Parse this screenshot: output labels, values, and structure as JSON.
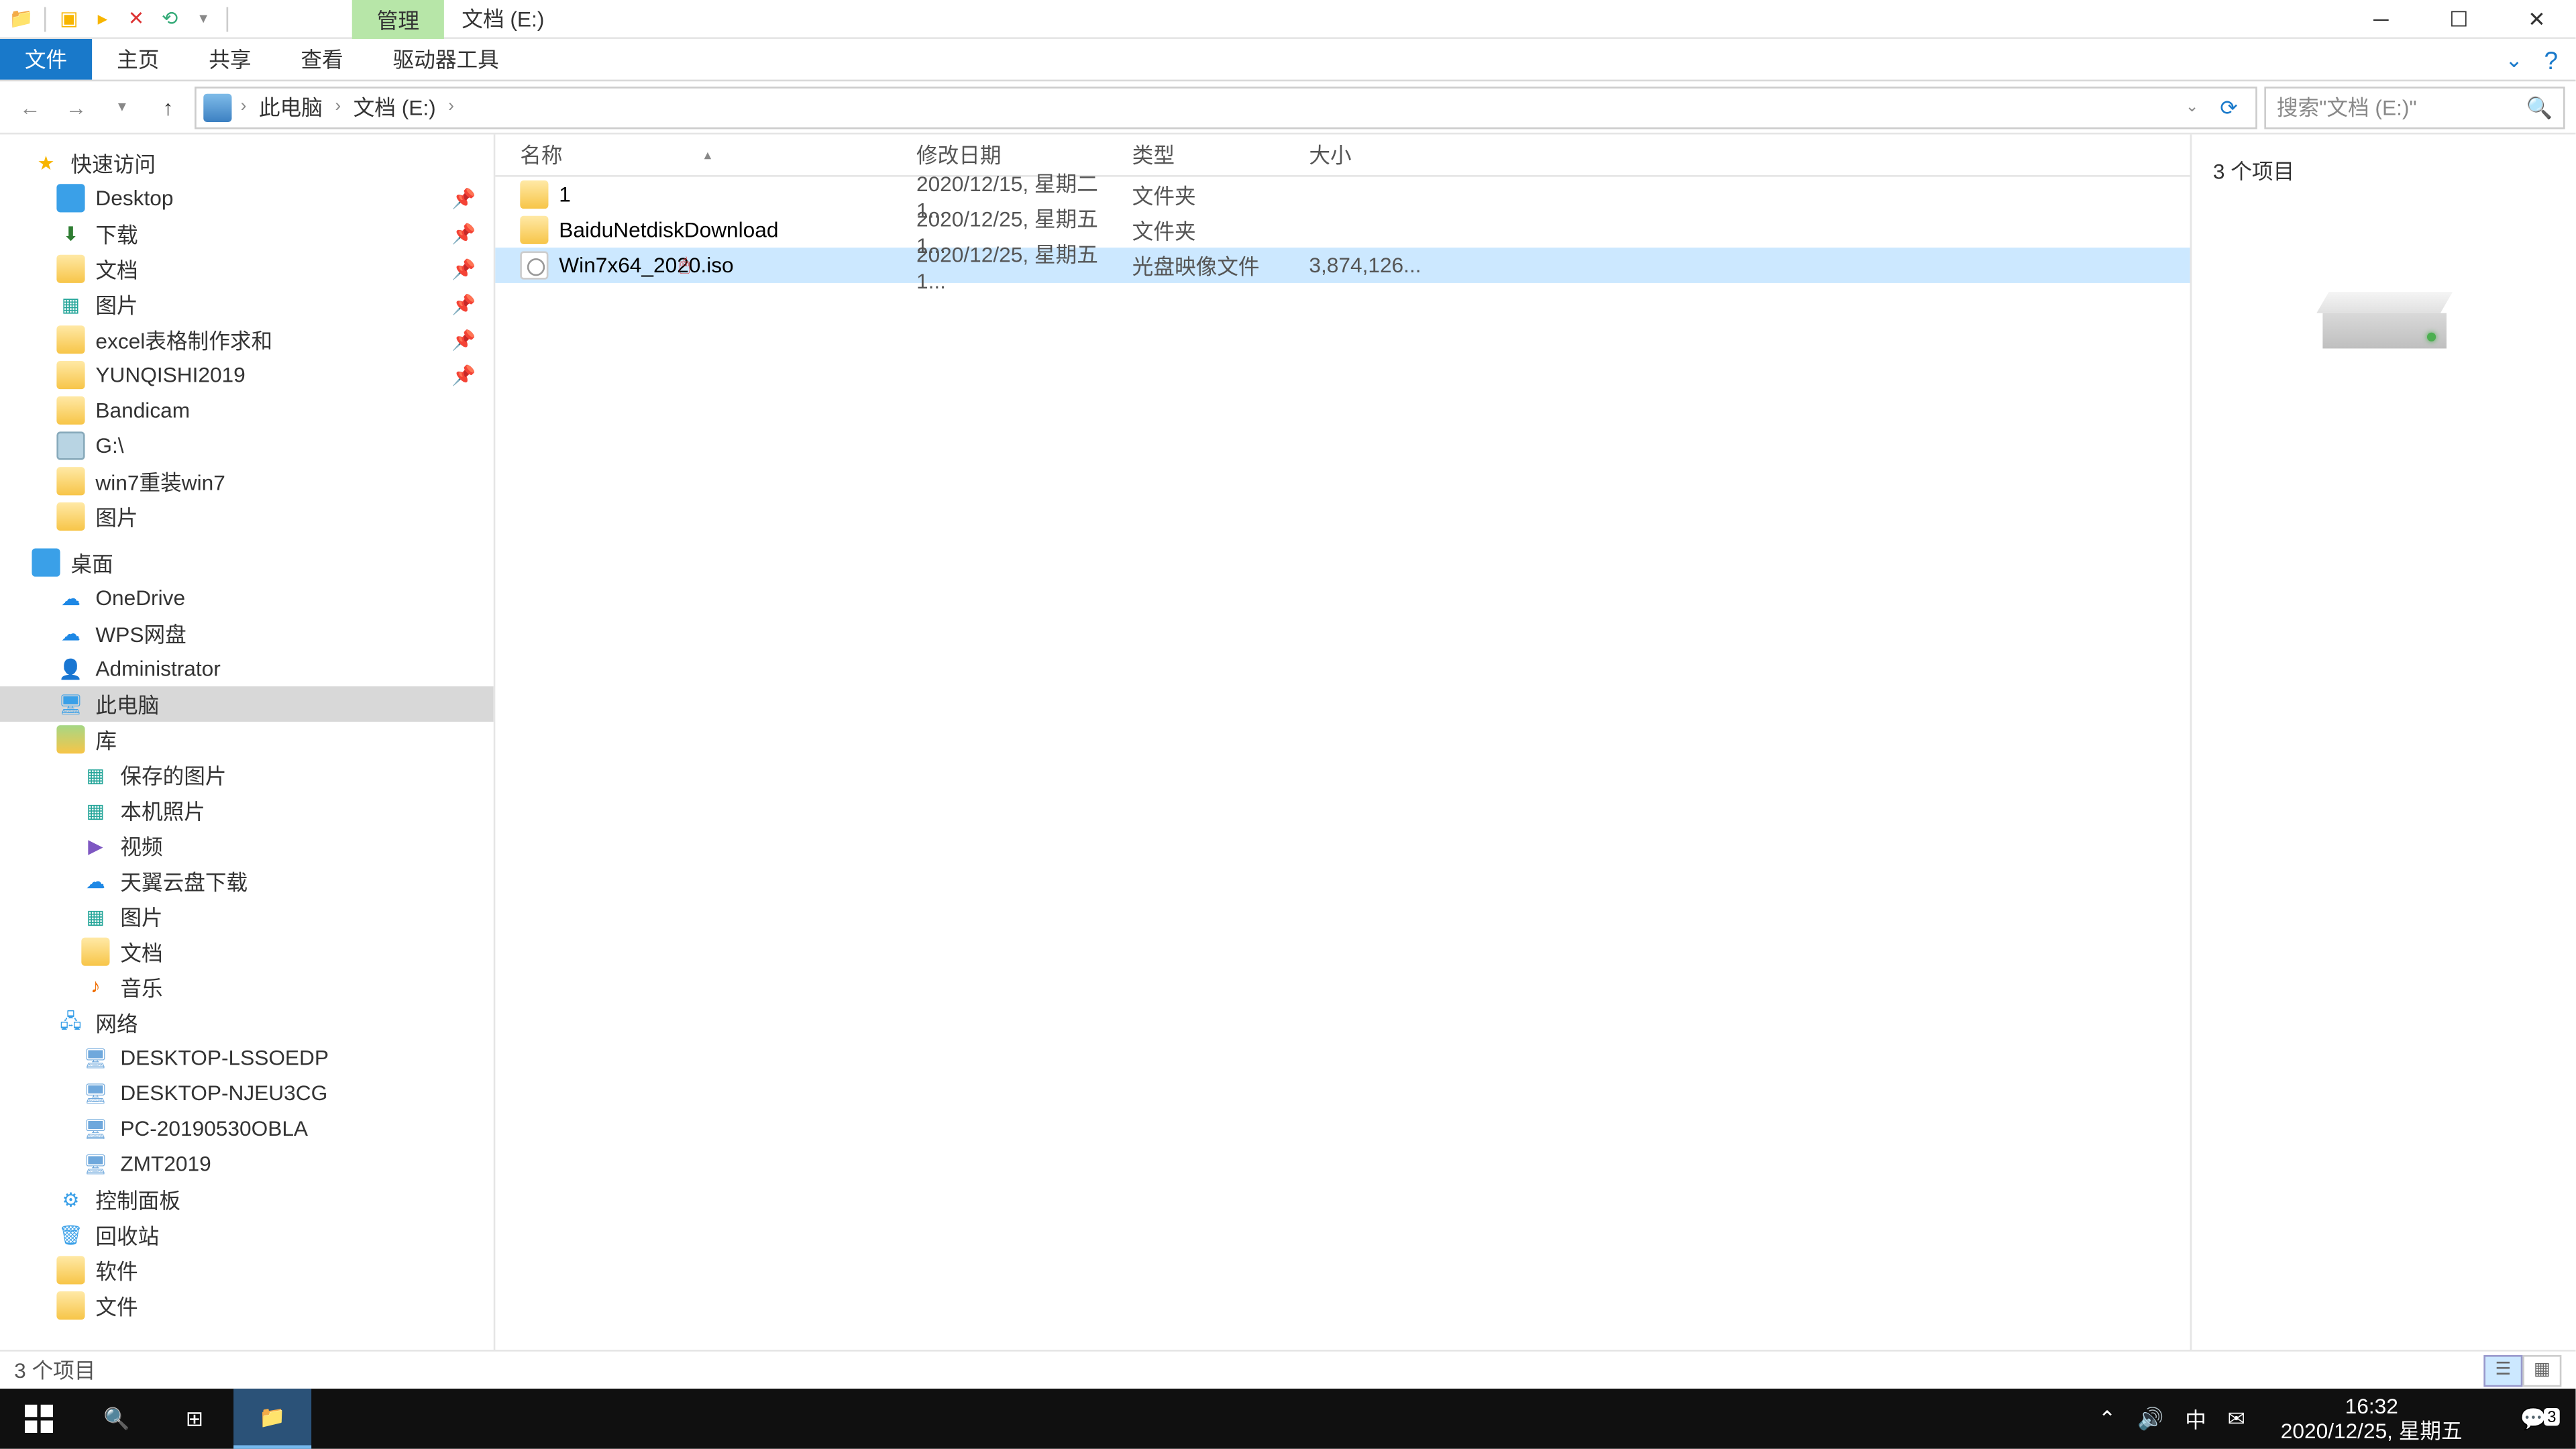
{
  "titlebar": {
    "context_tab": "管理",
    "title": "文档 (E:)"
  },
  "ribbon": {
    "file": "文件",
    "home": "主页",
    "share": "共享",
    "view": "查看",
    "drive_tools": "驱动器工具"
  },
  "address": {
    "crumb_pc": "此电脑",
    "crumb_drive": "文档 (E:)",
    "search_placeholder": "搜索\"文档 (E:)\""
  },
  "nav": {
    "quick_access": "快速访问",
    "desktop": "Desktop",
    "downloads": "下载",
    "documents": "文档",
    "pictures": "图片",
    "excel": "excel表格制作求和",
    "yunqishi": "YUNQISHI2019",
    "bandicam": "Bandicam",
    "gdrive": "G:\\",
    "win7reinstall": "win7重装win7",
    "pictures2": "图片",
    "desktop_cn": "桌面",
    "onedrive": "OneDrive",
    "wps": "WPS网盘",
    "admin": "Administrator",
    "thispc": "此电脑",
    "library": "库",
    "saved_pics": "保存的图片",
    "camera_roll": "本机照片",
    "videos": "视频",
    "tianyi": "天翼云盘下载",
    "pics_lib": "图片",
    "docs_lib": "文档",
    "music": "音乐",
    "network": "网络",
    "pc1": "DESKTOP-LSSOEDP",
    "pc2": "DESKTOP-NJEU3CG",
    "pc3": "PC-20190530OBLA",
    "pc4": "ZMT2019",
    "control_panel": "控制面板",
    "recycle": "回收站",
    "software": "软件",
    "files": "文件"
  },
  "columns": {
    "name": "名称",
    "date": "修改日期",
    "type": "类型",
    "size": "大小"
  },
  "files": [
    {
      "name": "1",
      "date": "2020/12/15, 星期二 1...",
      "type": "文件夹",
      "size": "",
      "icon": "folder",
      "selected": false
    },
    {
      "name": "BaiduNetdiskDownload",
      "date": "2020/12/25, 星期五 1...",
      "type": "文件夹",
      "size": "",
      "icon": "folder",
      "selected": false
    },
    {
      "name": "Win7x64_2020.iso",
      "date": "2020/12/25, 星期五 1...",
      "type": "光盘映像文件",
      "size": "3,874,126...",
      "icon": "iso",
      "selected": true
    }
  ],
  "preview": {
    "count_label": "3 个项目"
  },
  "status": {
    "text": "3 个项目"
  },
  "taskbar": {
    "time": "16:32",
    "date": "2020/12/25, 星期五",
    "ime": "中",
    "notif_count": "3"
  }
}
